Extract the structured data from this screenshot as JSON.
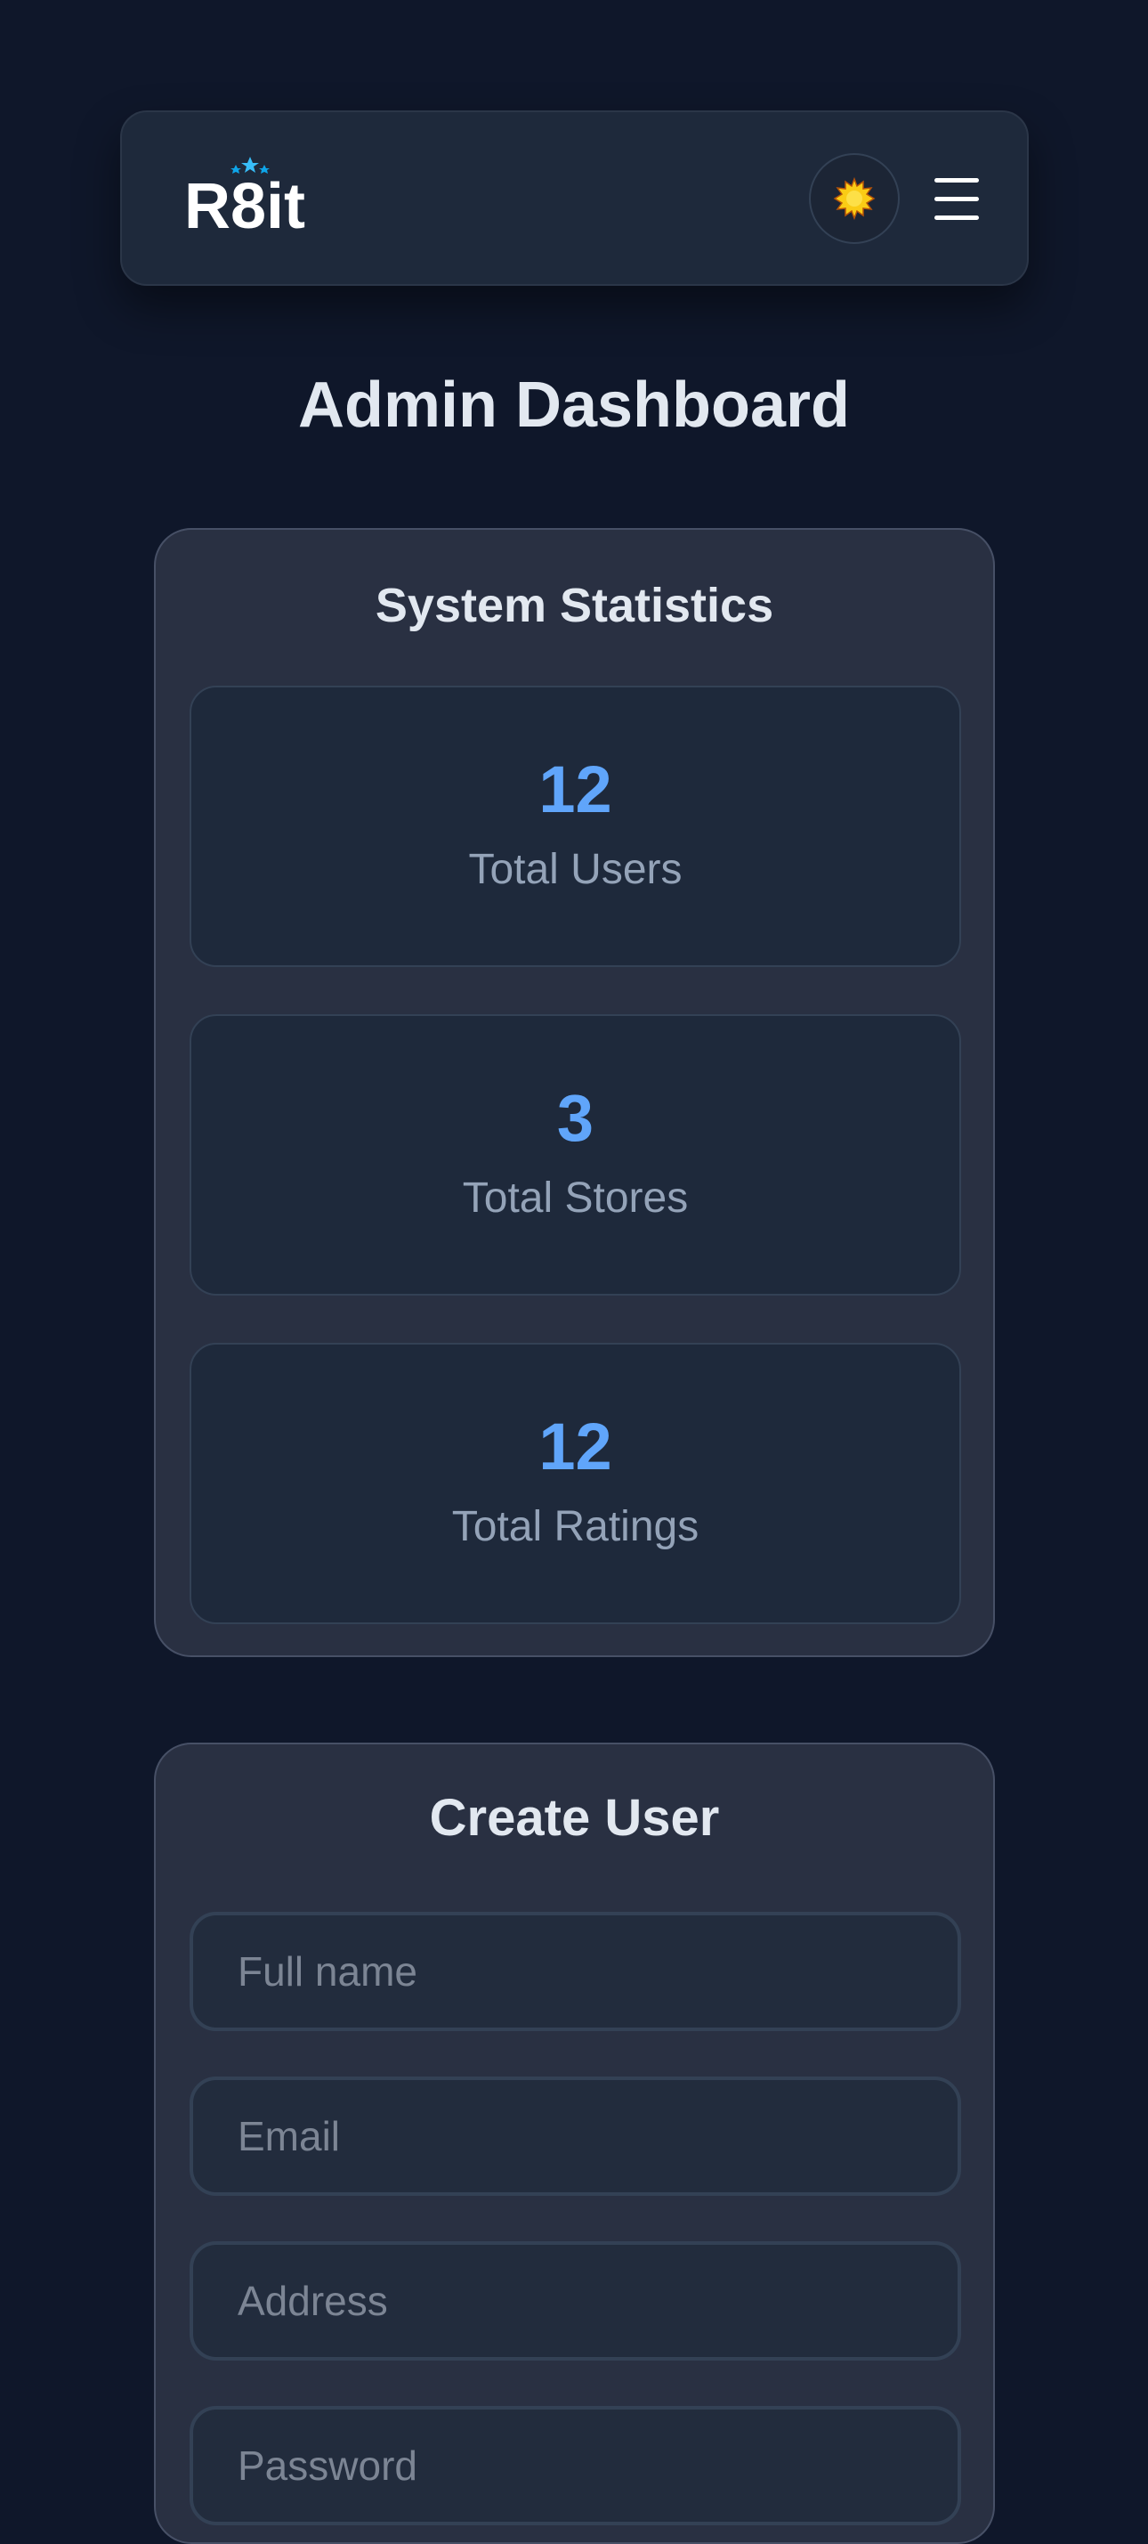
{
  "header": {
    "logo_text": "R8it",
    "theme_toggle_icon": "sun-icon",
    "menu_icon": "hamburger-menu-icon"
  },
  "page": {
    "title": "Admin Dashboard"
  },
  "stats": {
    "title": "System Statistics",
    "cards": [
      {
        "value": "12",
        "label": "Total Users"
      },
      {
        "value": "3",
        "label": "Total Stores"
      },
      {
        "value": "12",
        "label": "Total Ratings"
      }
    ]
  },
  "create_user": {
    "title": "Create User",
    "fields": [
      {
        "placeholder": "Full name",
        "value": ""
      },
      {
        "placeholder": "Email",
        "value": ""
      },
      {
        "placeholder": "Address",
        "value": ""
      },
      {
        "placeholder": "Password",
        "value": ""
      }
    ]
  },
  "colors": {
    "background": "#0f172a",
    "surface": "#1e293b",
    "panel": "#293042",
    "accent": "#60a5fa",
    "text": "#e2e8f0",
    "muted": "#94a3b8",
    "sun": "#facc15"
  }
}
